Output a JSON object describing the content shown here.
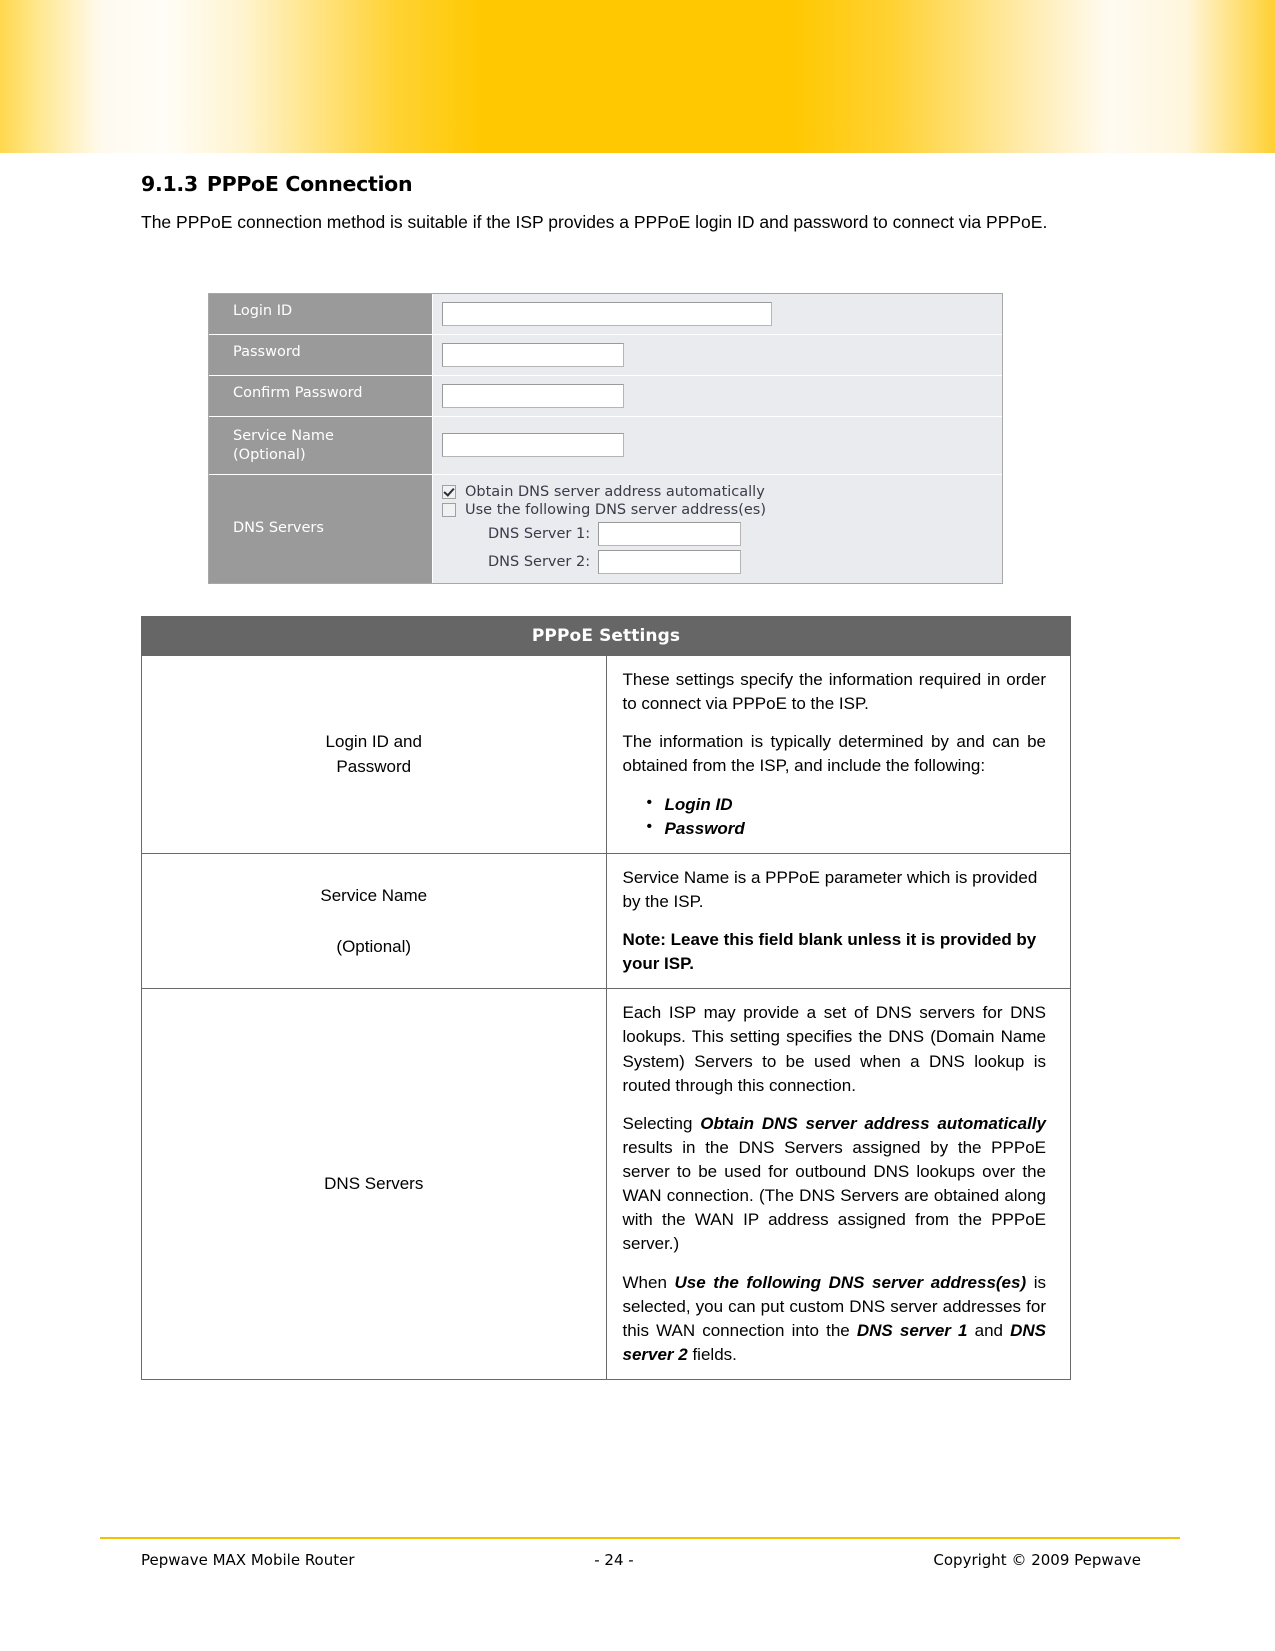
{
  "heading": {
    "number": "9.1.3",
    "title": "PPPoE Connection"
  },
  "intro": "The PPPoE connection method is suitable if the ISP provides a PPPoE login ID and password to connect via PPPoE.",
  "ui_form": {
    "rows": [
      {
        "label": "Login ID",
        "value": "",
        "placeholder": ""
      },
      {
        "label": "Password",
        "value": "",
        "placeholder": ""
      },
      {
        "label": "Confirm Password",
        "value": "",
        "placeholder": ""
      },
      {
        "label_line1": "Service Name",
        "label_line2": "(Optional)",
        "value": "",
        "placeholder": ""
      }
    ],
    "dns": {
      "label": "DNS Servers",
      "option_auto": "Obtain DNS server address automatically",
      "option_auto_checked": true,
      "option_manual": "Use the following DNS server address(es)",
      "option_manual_checked": false,
      "server1_label": "DNS Server 1:",
      "server1_value": "",
      "server2_label": "DNS Server 2:",
      "server2_value": ""
    }
  },
  "settings_table": {
    "title": "PPPoE Settings",
    "rows": [
      {
        "head_line1": "Login ID and",
        "head_line2": "Password",
        "para1": "These settings specify the information required in order to connect via PPPoE to the ISP.",
        "para2": "The information is typically determined by and can be obtained from the ISP, and include the following:",
        "bullets": [
          "Login ID",
          "Password"
        ]
      },
      {
        "head_line1": "Service Name",
        "head_line2": "(Optional)",
        "para1": "Service Name is a PPPoE parameter which is provided by the ISP.",
        "note": "Note: Leave this field blank unless it is provided by your ISP."
      },
      {
        "head_line1": "DNS Servers",
        "head_line2": "",
        "para1": "Each ISP may provide a set of DNS servers for DNS lookups.  This setting specifies the DNS (Domain Name System) Servers to be used when a DNS lookup is routed through this connection.",
        "para2_a": "Selecting ",
        "para2_bold": "Obtain DNS server address automatically",
        "para2_b": " results in the DNS Servers assigned by the PPPoE server to be used for outbound DNS lookups over the WAN connection.   (The DNS Servers are obtained along with the WAN IP address assigned from the PPPoE server.)",
        "para3_a": "When ",
        "para3_bold": "Use the following DNS server address(es)",
        "para3_b": " is selected, you can put custom DNS server addresses for this WAN connection into the ",
        "para3_bold2": "DNS server 1",
        "para3_c": " and ",
        "para3_bold3": "DNS server 2",
        "para3_d": " fields."
      }
    ]
  },
  "footer": {
    "left": "Pepwave MAX Mobile Router",
    "center": "- 24 -",
    "right": "Copyright © 2009 Pepwave"
  },
  "colors": {
    "banner_gold": "#ffc800",
    "table_header": "#666666",
    "ui_label_gray": "#9a9a9a",
    "ui_field_bg": "#e9ebee",
    "footer_rule": "#f2c200"
  }
}
